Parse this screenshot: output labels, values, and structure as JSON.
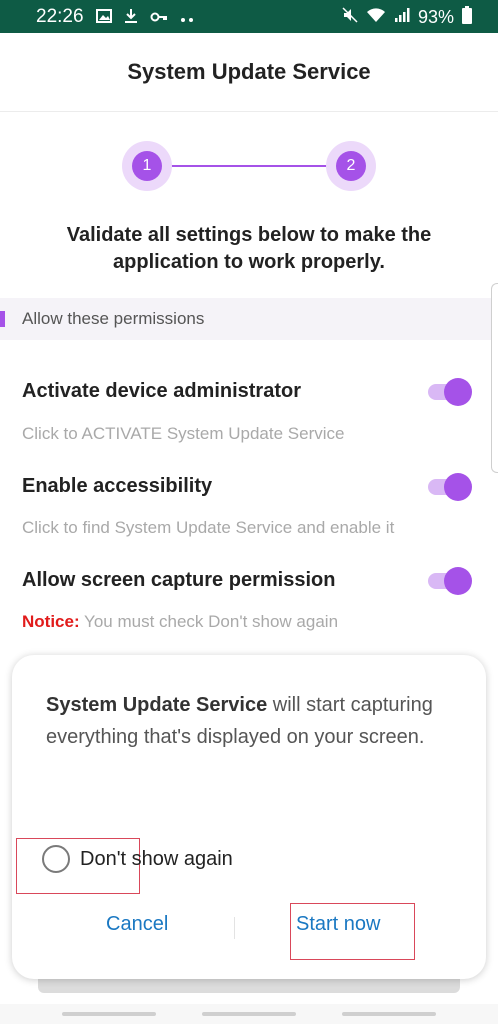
{
  "status_bar": {
    "time": "22:26",
    "battery": "93%",
    "left_icons": [
      "image-icon",
      "download-icon",
      "key-icon",
      "more-dots-icon"
    ],
    "right_icons": [
      "mute-icon",
      "wifi-icon",
      "signal-icon",
      "battery-icon"
    ],
    "background": "#0e5b45"
  },
  "header": {
    "title": "System Update Service"
  },
  "stepper": {
    "steps": [
      "1",
      "2"
    ],
    "accent": "#a552e8"
  },
  "validate_text": "Validate all settings below to make the application to work properly.",
  "section": {
    "label": "Allow these permissions"
  },
  "permissions": [
    {
      "title": "Activate device administrator",
      "description": "Click to ACTIVATE System Update Service",
      "enabled": true
    },
    {
      "title": "Enable accessibility",
      "description": "Click to find System Update Service and enable it",
      "enabled": true
    },
    {
      "title": "Allow screen capture permission",
      "notice_label": "Notice:",
      "description": " You must check Don't show again",
      "enabled": true
    }
  ],
  "dialog": {
    "app_name": "System Update Service",
    "message": " will start capturing everything that's displayed on your screen.",
    "checkbox_label": "Don't show again",
    "checkbox_checked": false,
    "cancel_label": "Cancel",
    "start_label": "Start now"
  }
}
